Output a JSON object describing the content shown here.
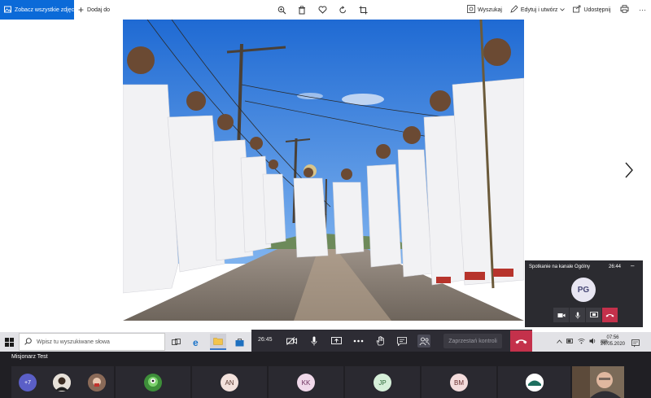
{
  "toolbar": {
    "see_all_label": "Zobacz wszystkie zdjęcia",
    "add_to_label": "Dodaj do",
    "search_label": "Wyszukaj",
    "edit_label": "Edytuj i utwórz",
    "share_label": "Udostępnij",
    "more_label": "···"
  },
  "call_window": {
    "title": "Spotkanie na kanale Ogólny",
    "time": "26:44",
    "avatar_initials": "PG"
  },
  "taskbar": {
    "search_placeholder": "Wpisz tu wyszukiwane słowa",
    "time": "07:56",
    "date": "26.05.2020"
  },
  "call_bar": {
    "timer": "26:45",
    "leave_control_label": "Zaprzestań kontroli"
  },
  "meeting": {
    "presenter_name": "Misjonarz Test",
    "overflow_count": "+7",
    "participants": [
      {
        "initials": "AN"
      },
      {
        "initials": "KK"
      },
      {
        "initials": "JP"
      },
      {
        "initials": "BM"
      }
    ]
  },
  "colors": {
    "accent": "#0b6ad8",
    "hangup": "#c4314b",
    "teams_dark": "#201f24",
    "sky": "#2c74d6"
  }
}
